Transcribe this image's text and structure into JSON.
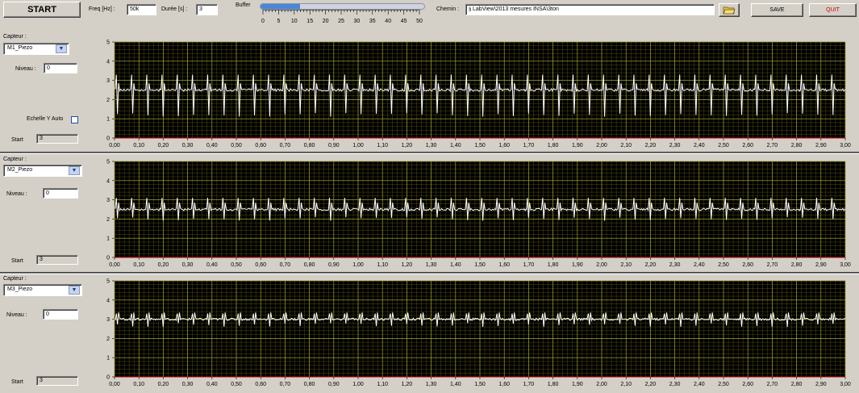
{
  "toolbar": {
    "start_label": "START",
    "freq_label": "Freq [Hz] :",
    "freq_value": "50k",
    "duree_label": "Durée [s] :",
    "duree_value": "3",
    "buffer_label": "Buffer",
    "buffer_fill_fraction": 0.24,
    "buffer_ticks": [
      "0",
      "5",
      "10",
      "15",
      "20",
      "25",
      "30",
      "35",
      "40",
      "45",
      "50"
    ],
    "chemin_label": "Chemin :",
    "chemin_value": "LabView\\2013 mesures INSA\\3ton",
    "save_label": "SAVE",
    "quit_label": "QUIT",
    "quit_color": "#cc0000"
  },
  "colors": {
    "plot_bg": "#000000",
    "grid": "#b7b32a",
    "grid_minor": "#4f4d12",
    "trace": "#ffffff",
    "xaxis_line": "#c00000"
  },
  "panels": [
    {
      "capteur_label": "Capteur :",
      "capteur_value": "M1_Piezo",
      "niveau_label": "Niveau :",
      "niveau_value": "0",
      "echelle_label": "Echelle Y Auto",
      "start_label": "Start",
      "start_value": "3"
    },
    {
      "capteur_label": "Capteur :",
      "capteur_value": "M2_Piezo",
      "niveau_label": "Niveau :",
      "niveau_value": "0",
      "start_label": "Start",
      "start_value": "3"
    },
    {
      "capteur_label": "Capteur :",
      "capteur_value": "M3_Piezo",
      "niveau_label": "Niveau :",
      "niveau_value": "0",
      "start_label": "Start",
      "start_value": "3"
    }
  ],
  "chart_data": [
    {
      "type": "line",
      "ylim": [
        0,
        5
      ],
      "xlim": [
        0,
        3
      ],
      "y_ticks": [
        "0",
        "1",
        "2",
        "3",
        "4",
        "5"
      ],
      "x_ticks": [
        "0,00",
        "0,10",
        "0,20",
        "0,30",
        "0,40",
        "0,50",
        "0,60",
        "0,70",
        "0,80",
        "0,90",
        "1,00",
        "1,10",
        "1,20",
        "1,30",
        "1,40",
        "1,50",
        "1,60",
        "1,70",
        "1,80",
        "1,90",
        "2,00",
        "2,10",
        "2,20",
        "2,30",
        "2,40",
        "2,50",
        "2,60",
        "2,70",
        "2,80",
        "2,90",
        "3,00"
      ],
      "baseline": 2.5,
      "pulse_count": 48,
      "pulse_high": 3.3,
      "pulse_low": 1.1
    },
    {
      "type": "line",
      "ylim": [
        0,
        5
      ],
      "xlim": [
        0,
        3
      ],
      "y_ticks": [
        "0",
        "1",
        "2",
        "3",
        "4",
        "5"
      ],
      "x_ticks": [
        "0,00",
        "0,10",
        "0,20",
        "0,30",
        "0,40",
        "0,50",
        "0,60",
        "0,70",
        "0,80",
        "0,90",
        "1,00",
        "1,10",
        "1,20",
        "1,30",
        "1,40",
        "1,50",
        "1,60",
        "1,70",
        "1,80",
        "1,90",
        "2,00",
        "2,10",
        "2,20",
        "2,30",
        "2,40",
        "2,50",
        "2,60",
        "2,70",
        "2,80",
        "2,90",
        "3,00"
      ],
      "baseline": 2.5,
      "pulse_count": 48,
      "pulse_high": 3.1,
      "pulse_low": 1.9
    },
    {
      "type": "line",
      "ylim": [
        0,
        5
      ],
      "xlim": [
        0,
        3
      ],
      "y_ticks": [
        "0",
        "1",
        "2",
        "3",
        "4",
        "5"
      ],
      "x_ticks": [
        "0,00",
        "0,10",
        "0,20",
        "0,30",
        "0,40",
        "0,50",
        "0,60",
        "0,70",
        "0,80",
        "0,90",
        "1,00",
        "1,10",
        "1,20",
        "1,30",
        "1,40",
        "1,50",
        "1,60",
        "1,70",
        "1,80",
        "1,90",
        "2,00",
        "2,10",
        "2,20",
        "2,30",
        "2,40",
        "2,50",
        "2,60",
        "2,70",
        "2,80",
        "2,90",
        "3,00"
      ],
      "baseline": 3.0,
      "pulse_count": 48,
      "pulse_high": 3.3,
      "pulse_low": 2.6
    }
  ]
}
